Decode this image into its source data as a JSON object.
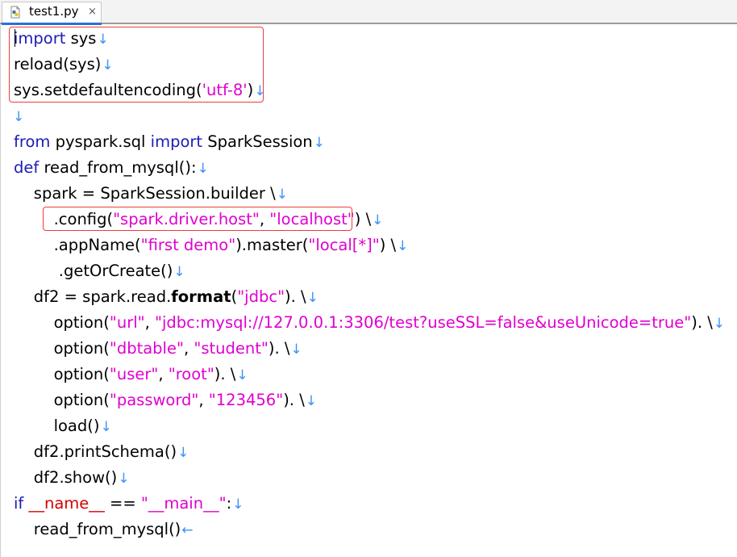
{
  "tab": {
    "title": "test1.py",
    "close": "×",
    "icon": "python-file-icon"
  },
  "editor": {
    "newline_marker": "↓",
    "eof_marker": "←"
  },
  "code": {
    "l1_kw": "import",
    "l1_rest": " sys",
    "l2": "reload(sys)",
    "l3_a": "sys.setdefaultencoding(",
    "l3_s": "'utf-8'",
    "l3_b": ")",
    "l5_kw1": "from",
    "l5_mid": " pyspark.sql ",
    "l5_kw2": "import",
    "l5_rest": " SparkSession",
    "l6_kw": "def",
    "l6_rest": " read_from_mysql():",
    "l7": "    spark = SparkSession.builder \\",
    "l8_a": "        .config(",
    "l8_s1": "\"spark.driver.host\"",
    "l8_b": ", ",
    "l8_s2": "\"localhost\"",
    "l8_c": ") \\",
    "l9_a": "        .appName(",
    "l9_s1": "\"first demo\"",
    "l9_b": ").master(",
    "l9_s2": "\"local[*]\"",
    "l9_c": ") \\",
    "l10": "         .getOrCreate()",
    "l11_a": "    df2 = spark.read.",
    "l11_bold": "format",
    "l11_b": "(",
    "l11_s": "\"jdbc\"",
    "l11_c": "). \\",
    "l12_a": "        option(",
    "l12_s1": "\"url\"",
    "l12_b": ", ",
    "l12_s2": "\"jdbc:mysql://127.0.0.1:3306/test?useSSL=false&useUnicode=true\"",
    "l12_c": "). \\",
    "l13_a": "        option(",
    "l13_s1": "\"dbtable\"",
    "l13_b": ", ",
    "l13_s2": "\"student\"",
    "l13_c": "). \\",
    "l14_a": "        option(",
    "l14_s1": "\"user\"",
    "l14_b": ", ",
    "l14_s2": "\"root\"",
    "l14_c": "). \\",
    "l15_a": "        option(",
    "l15_s1": "\"password\"",
    "l15_b": ", ",
    "l15_s2": "\"123456\"",
    "l15_c": "). \\",
    "l16": "        load()",
    "l17": "    df2.printSchema()",
    "l18": "    df2.show()",
    "l19_kw": "if",
    "l19_sp": " ",
    "l19_d": "__name__",
    "l19_eq": " == ",
    "l19_s": "\"__main__\"",
    "l19_c": ":",
    "l20": "    read_from_mysql()"
  }
}
